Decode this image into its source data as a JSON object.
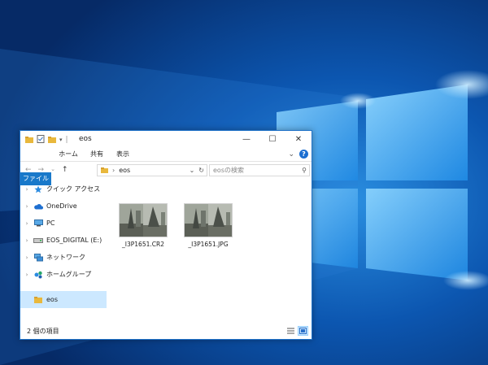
{
  "window": {
    "title": "eos",
    "controls": {
      "minimize": "—",
      "maximize": "☐",
      "close": "✕"
    }
  },
  "ribbon": {
    "tabs": [
      "ファイル",
      "ホーム",
      "共有",
      "表示"
    ],
    "collapse": "⌄",
    "help": "?"
  },
  "address": {
    "back": "←",
    "forward": "→",
    "recent": "⌄",
    "up": "↑",
    "separator": "›",
    "path": "eos",
    "dropdown": "⌄",
    "refresh": "↻"
  },
  "search": {
    "placeholder": "eosの検索",
    "icon": "⚲"
  },
  "nav": [
    {
      "label": "クイック アクセス",
      "icon": "star-icon",
      "chevron": "›"
    },
    {
      "label": "OneDrive",
      "icon": "cloud-icon",
      "chevron": "›"
    },
    {
      "label": "PC",
      "icon": "computer-icon",
      "chevron": "›"
    },
    {
      "label": "EOS_DIGITAL (E:)",
      "icon": "drive-icon",
      "chevron": "›"
    },
    {
      "label": "ネットワーク",
      "icon": "network-icon",
      "chevron": "›"
    },
    {
      "label": "ホームグループ",
      "icon": "homegroup-icon",
      "chevron": "›"
    },
    {
      "label": "eos",
      "icon": "folder-icon",
      "selected": true
    }
  ],
  "files": [
    {
      "name": "_I3P1651.CR2"
    },
    {
      "name": "_I3P1651.JPG"
    }
  ],
  "status": {
    "count": "2 個の項目"
  },
  "colors": {
    "accent": "#1979ca",
    "selection": "#cce8ff",
    "folder": "#e9b83c"
  }
}
